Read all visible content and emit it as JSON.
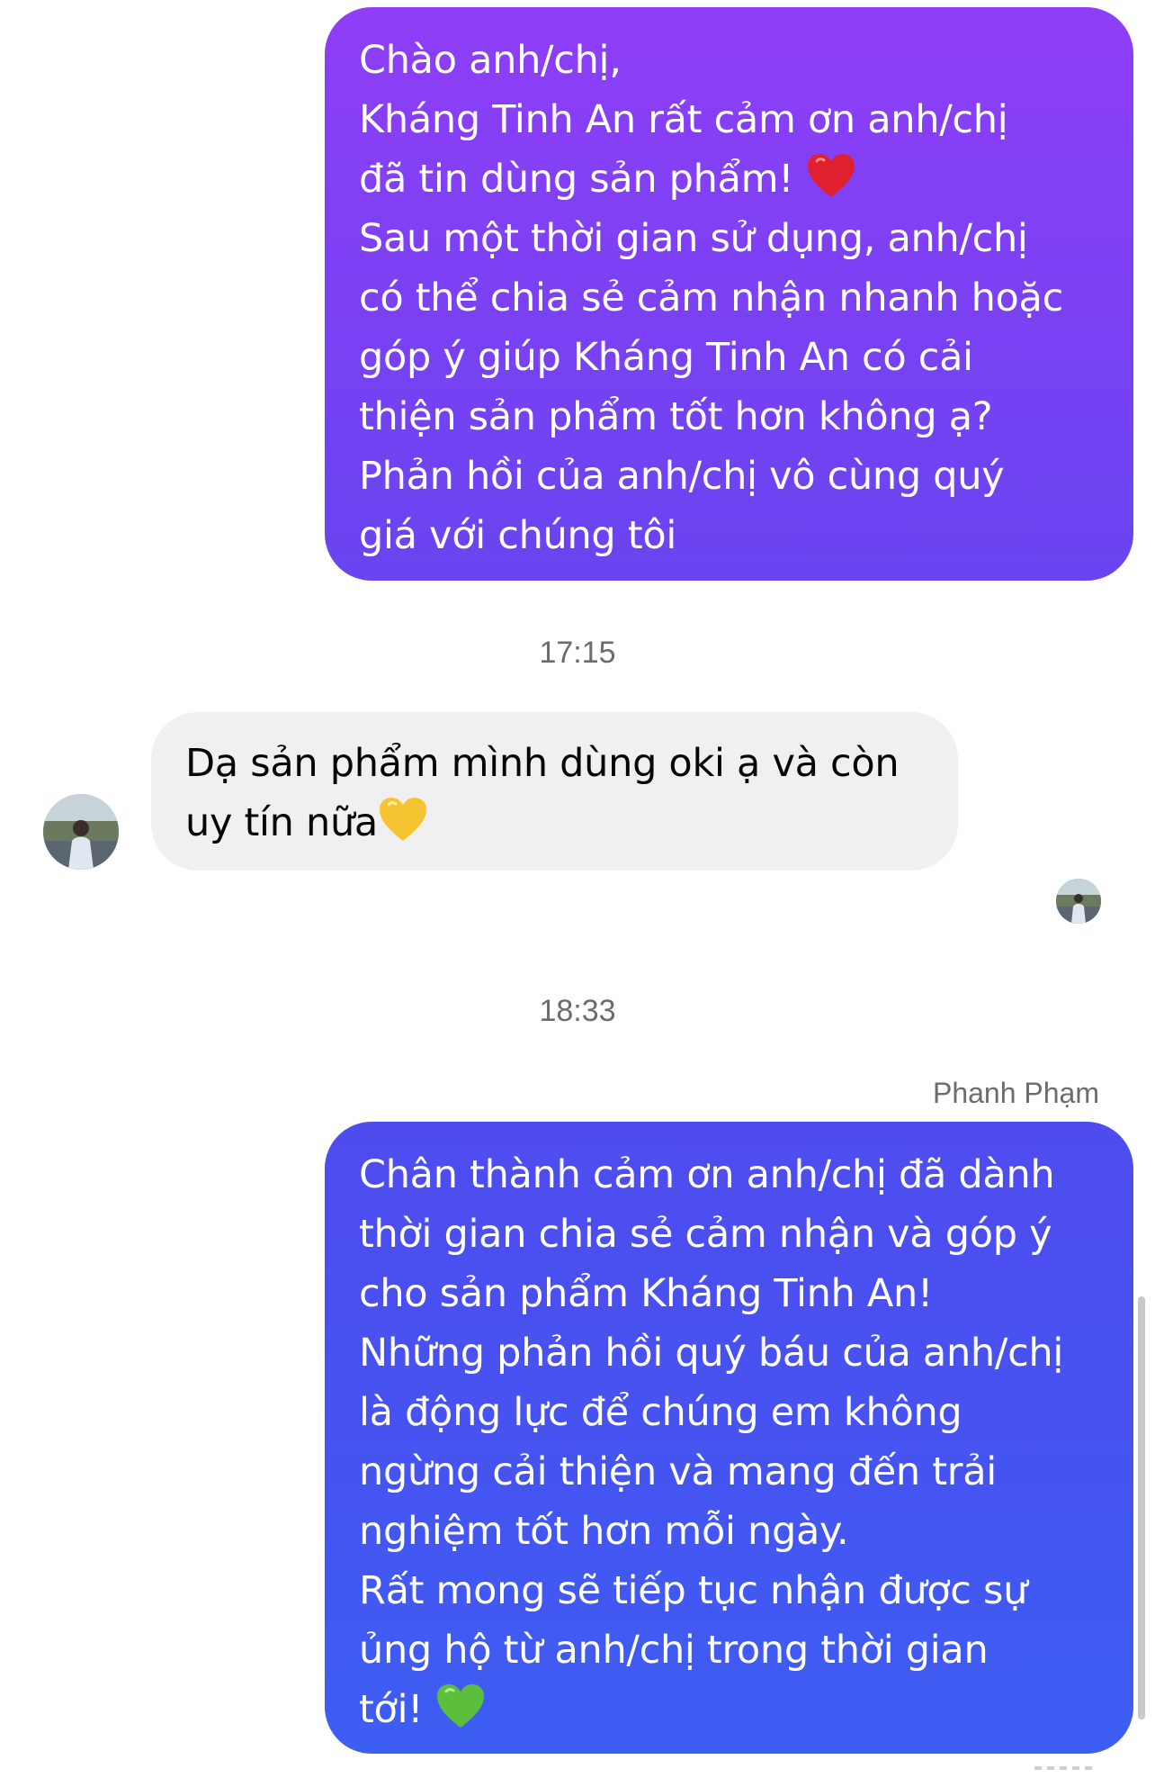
{
  "conversation": {
    "messages": [
      {
        "lines": [
          "Chào anh/chị,",
          "Kháng Tinh An rất cảm ơn anh/chị",
          "đã tin dùng sản phẩm! ",
          "Sau một thời gian sử dụng, anh/chị",
          "có thể chia sẻ cảm nhận nhanh hoặc",
          "góp ý giúp Kháng Tinh An có cải",
          "thiện sản phẩm tốt hơn không ạ?",
          "Phản hồi của anh/chị vô cùng quý",
          "giá với chúng tôi"
        ],
        "emoji": "red-heart"
      },
      {
        "timestamp": "17:15"
      },
      {
        "lines": [
          "Dạ sản phẩm mình dùng oki ạ và còn",
          "uy tín nữa"
        ],
        "emoji": "yellow-heart"
      },
      {
        "timestamp": "18:33"
      },
      {
        "sender": "Phanh Phạm",
        "lines": [
          "Chân thành cảm ơn anh/chị đã dành",
          "thời gian chia sẻ cảm nhận và góp ý",
          "cho sản phẩm Kháng Tinh An!",
          "Những phản hồi quý báu của anh/chị",
          "là động lực để chúng em không",
          "ngừng cải thiện và mang đến trải",
          "nghiệm tốt hơn mỗi ngày.",
          "Rất mong sẽ tiếp tục nhận được sự",
          "ủng hộ từ anh/chị trong thời gian",
          "tới! "
        ],
        "emoji": "green-heart"
      }
    ]
  },
  "colors": {
    "outgoing_1_top": "#8e3ef6",
    "outgoing_1_bottom": "#6845f0",
    "outgoing_2_top": "#4f4cef",
    "outgoing_2_bottom": "#3d5ef3",
    "incoming": "#f0f0f2",
    "meta_text": "#6b6b70"
  }
}
